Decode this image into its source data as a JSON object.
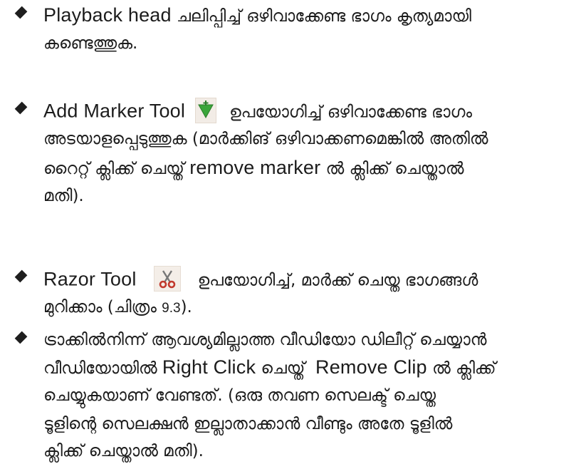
{
  "items": [
    {
      "lines": [
        {
          "a": "Playback head",
          "b": " ചലിപ്പിച്ച് ഒഴിവാക്കേണ്ട ഭാഗം കൃത്യമായി"
        },
        {
          "a": "",
          "b": "കണ്ടെത്തുക."
        }
      ]
    },
    {
      "lines": [
        {
          "a": "Add Marker Tool",
          "b": "ഉപയോഗിച്ച് ഒഴിവാക്കേണ്ട ഭാഗം"
        },
        {
          "a": "",
          "b": "അടയാളപ്പെടുത്തുക (മാർക്കിങ് ഒഴിവാക്കണമെങ്കിൽ അതിൽ"
        },
        {
          "a": "റൈറ്റ് ക്ലിക്ക് ചെയ്ത് ",
          "m": "remove marker",
          "b": " ൽ ക്ലിക്ക് ചെയ്താൽ"
        },
        {
          "a": "",
          "b": "മതി)."
        }
      ]
    },
    {
      "lines": [
        {
          "a": "Razor Tool",
          "b": "ഉപയോഗിച്ച്, മാർക്ക് ചെയ്ത ഭാഗങ്ങൾ"
        },
        {
          "a": "മുറിക്കാം (ചിത്രം ",
          "m": "9.3",
          "b": ")."
        }
      ]
    },
    {
      "lines": [
        {
          "a": "",
          "b": "ട്രാക്കിൽനിന്ന് ആവശ്യമില്ലാത്ത വീഡിയോ ഡിലീറ്റ് ചെയ്യാൻ"
        },
        {
          "a": "വീഡിയോയിൽ ",
          "m": "Right Click",
          "b": " ചെയ്ത്"
        },
        {
          "a": "",
          "m": "Remove Clip",
          "b": " ൽ ക്ലിക്ക്"
        },
        {
          "a": "",
          "b": "ചെയ്യുകയാണ് വേണ്ടത്. (ഒരു തവണ സെലക്ട് ചെയ്ത"
        },
        {
          "a": "",
          "b": "ടൂളിന്റെ സെലക്ഷൻ ഇല്ലാതാക്കാൻ വീണ്ടും അതേ ടൂളിൽ"
        },
        {
          "a": "",
          "b": "ക്ലിക്ക് ചെയ്താൽ മതി)."
        }
      ]
    }
  ],
  "icons": {
    "marker": "add-marker-icon",
    "razor": "razor-scissors-icon"
  },
  "colors": {
    "marker_green": "#3aa53a",
    "razor_red": "#c23a2e",
    "text": "#1c1c1c"
  }
}
